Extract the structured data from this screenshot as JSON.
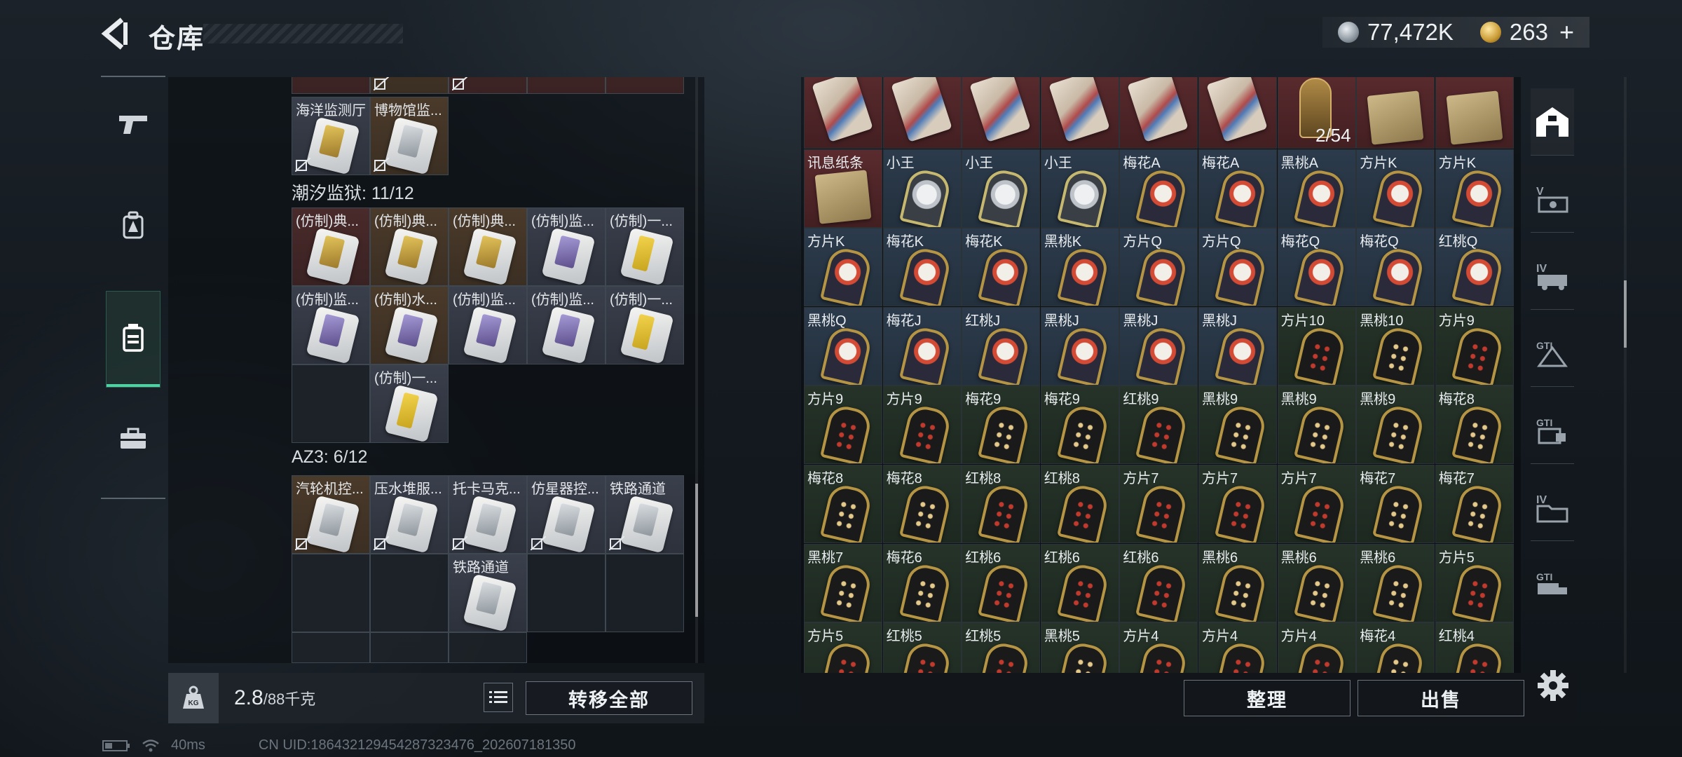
{
  "header": {
    "title": "仓库",
    "silver": "77,472K",
    "gold": "263",
    "gold_plus": "+"
  },
  "colors": {
    "accent": "#4fd1a3",
    "panel": "#0a0d10",
    "card_gold": "#b59544"
  },
  "left_rail": {
    "tabs": [
      {
        "icon": "pistol-icon"
      },
      {
        "icon": "backpack-icon"
      },
      {
        "icon": "container-icon",
        "active": true
      },
      {
        "icon": "briefcase-icon"
      }
    ]
  },
  "storage": {
    "top_row_labels": [
      "海洋监测厅",
      "博物馆监..."
    ],
    "groups": [
      {
        "title": "潮汐监狱: 11/12",
        "items": [
          "(仿制)典...",
          "(仿制)典...",
          "(仿制)典...",
          "(仿制)监...",
          "(仿制)一...",
          "(仿制)监...",
          "(仿制)水...",
          "(仿制)监...",
          "(仿制)监...",
          "(仿制)一...",
          "(仿制)一..."
        ]
      },
      {
        "title": "AZ3: 6/12",
        "items": [
          "汽轮机控...",
          "压水堆服...",
          "托卡马克...",
          "仿星器控...",
          "铁路通道",
          "铁路通道"
        ]
      }
    ]
  },
  "weight": {
    "value": "2.8",
    "unit": "/88千克",
    "icon": "weight-kg-icon"
  },
  "buttons": {
    "transfer_all": "转移全部",
    "organize": "整理",
    "sell": "出售"
  },
  "inventory": {
    "row0": [
      "",
      "",
      "",
      "",
      "",
      "",
      "",
      "",
      ""
    ],
    "row0_count": "2/54",
    "rows": [
      [
        "讯息纸条",
        "小王",
        "小王",
        "小王",
        "梅花A",
        "梅花A",
        "黑桃A",
        "方片K",
        "方片K"
      ],
      [
        "方片K",
        "梅花K",
        "梅花K",
        "黑桃K",
        "方片Q",
        "方片Q",
        "梅花Q",
        "梅花Q",
        "红桃Q"
      ],
      [
        "黑桃Q",
        "梅花J",
        "红桃J",
        "黑桃J",
        "黑桃J",
        "黑桃J",
        "方片10",
        "黑桃10",
        "方片9"
      ],
      [
        "方片9",
        "方片9",
        "梅花9",
        "梅花9",
        "红桃9",
        "黑桃9",
        "黑桃9",
        "黑桃9",
        "梅花8"
      ],
      [
        "梅花8",
        "梅花8",
        "红桃8",
        "红桃8",
        "方片7",
        "方片7",
        "方片7",
        "梅花7",
        "梅花7"
      ],
      [
        "黑桃7",
        "梅花6",
        "红桃6",
        "红桃6",
        "红桃6",
        "黑桃6",
        "黑桃6",
        "黑桃6",
        "方片5"
      ],
      [
        "方片5",
        "红桃5",
        "红桃5",
        "黑桃5",
        "方片4",
        "方片4",
        "方片4",
        "梅花4",
        "红桃4"
      ]
    ]
  },
  "right_rail": {
    "tabs": [
      {
        "icon": "vault-icon",
        "active": true
      },
      {
        "icon": "v-slot-icon"
      },
      {
        "icon": "iv-vehicle-icon"
      },
      {
        "icon": "gti-triangle-icon"
      },
      {
        "icon": "gti-lock-icon"
      },
      {
        "icon": "iv-folder-icon"
      },
      {
        "icon": "gti-truck-icon"
      }
    ]
  },
  "status": {
    "ping": "40ms",
    "uid": "CN UID:186432129454287323476_202607181350"
  }
}
